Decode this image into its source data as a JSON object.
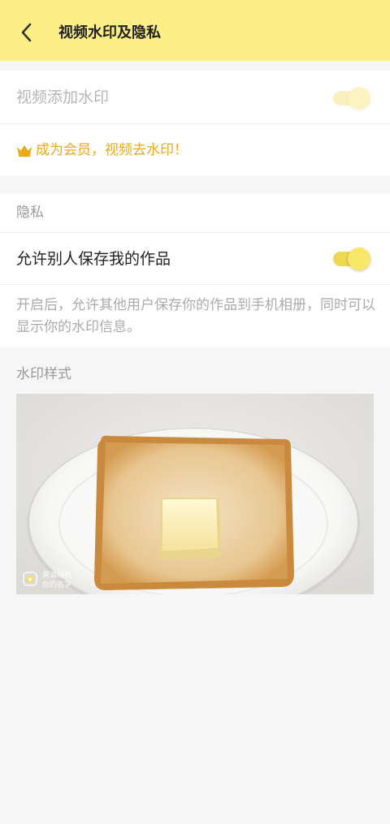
{
  "header": {
    "title": "视频水印及隐私",
    "back_icon": "chevron-left-icon",
    "background_color": "#fdef86"
  },
  "watermark_card": {
    "add_watermark_label": "视频添加水印",
    "add_watermark_enabled": true,
    "add_watermark_disabled_state": true,
    "member_link_text": "成为会员，视频去水印！",
    "member_icon": "crown-icon",
    "accent_color": "#e9aa1a"
  },
  "privacy_card": {
    "section_label": "隐私",
    "allow_save_label": "允许别人保存我的作品",
    "allow_save_enabled": true,
    "description": "开启后，允许其他用户保存你的作品到手机相册，同时可以显示你的水印信息。",
    "toggle_on_color": "#f5e15f"
  },
  "watermark_style": {
    "section_label": "水印样式",
    "preview_image": "toast-with-butter-on-plate",
    "watermark_app_name": "黄油相机",
    "watermark_user_name": "你的名字"
  }
}
